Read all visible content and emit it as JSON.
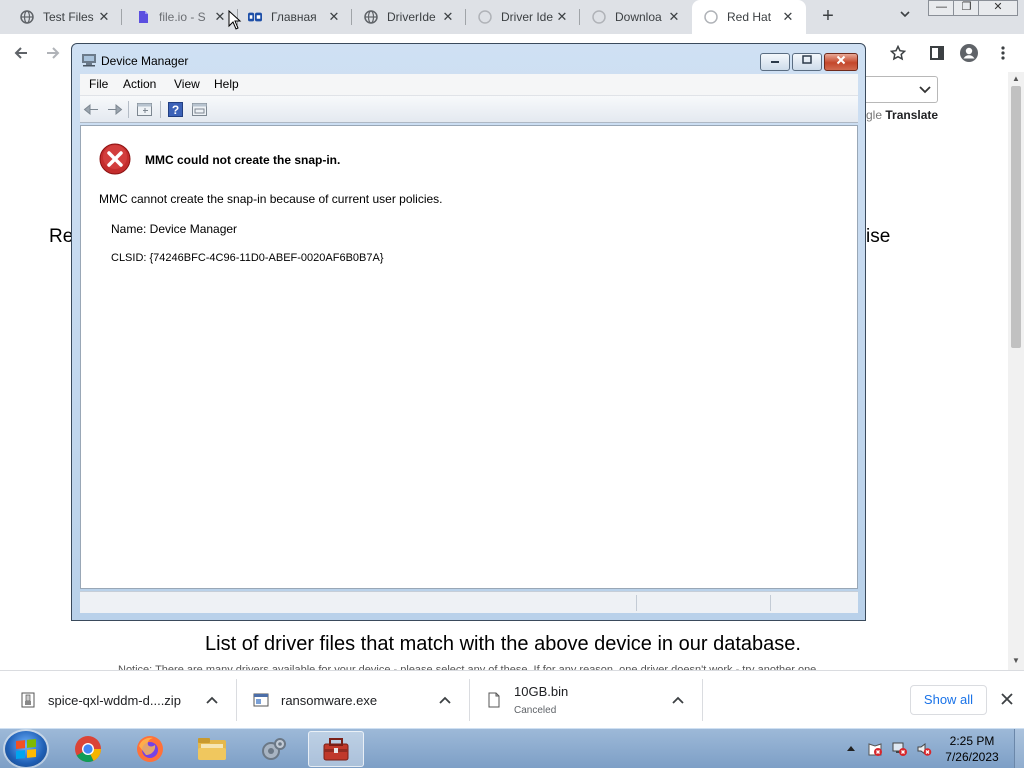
{
  "browser": {
    "tabs": [
      {
        "label": "Test Files",
        "icon": "globe-icon",
        "active": false
      },
      {
        "label": "file.io - S",
        "icon": "fileio-icon",
        "active": false
      },
      {
        "label": "Главная",
        "icon": "driverpack-icon",
        "active": false
      },
      {
        "label": "DriverIde",
        "icon": "globe-icon",
        "active": false
      },
      {
        "label": "Driver Ide",
        "icon": "globe-icon",
        "active": false
      },
      {
        "label": "Downloa",
        "icon": "globe-icon",
        "active": false
      },
      {
        "label": "Red Hat",
        "icon": "globe-icon",
        "active": true
      }
    ],
    "close_glyph": "✕",
    "new_tab_glyph": "+",
    "window_buttons": {
      "minimize": "—",
      "restore": "❐",
      "close": "✕"
    }
  },
  "page": {
    "left_fragment": "Re",
    "right_fragment": "ise",
    "translate_prefix": "gle",
    "translate_label": "Translate",
    "list_heading": "List of driver files that match with the above device in our database.",
    "notice": "Notice: There are many drivers available for your device - please select any of these. If for any reason, one driver doesn't work - try another one."
  },
  "downloads": {
    "items": [
      {
        "name": "spice-qxl-wddm-d....zip",
        "status": ""
      },
      {
        "name": "ransomware.exe",
        "status": ""
      },
      {
        "name": "10GB.bin",
        "status": "Canceled"
      }
    ],
    "show_all": "Show all"
  },
  "taskbar": {
    "apps": [
      "chrome",
      "firefox",
      "file-explorer",
      "system-settings",
      "device-manager"
    ],
    "time": "2:25 PM",
    "date": "7/26/2023"
  },
  "device_manager": {
    "title": "Device Manager",
    "menu": [
      "File",
      "Action",
      "View",
      "Help"
    ],
    "error_title": "MMC could not create the snap-in.",
    "error_message": "MMC cannot create the snap-in because of current user policies.",
    "name_line": "Name: Device Manager",
    "clsid_line": "CLSID: {74246BFC-4C96-11D0-ABEF-0020AF6B0B7A}"
  },
  "colors": {
    "tabstrip": "#dee1e6",
    "link_blue": "#1a73e8",
    "error_red": "#d7262b",
    "taskbar": "#8fb0d4"
  }
}
